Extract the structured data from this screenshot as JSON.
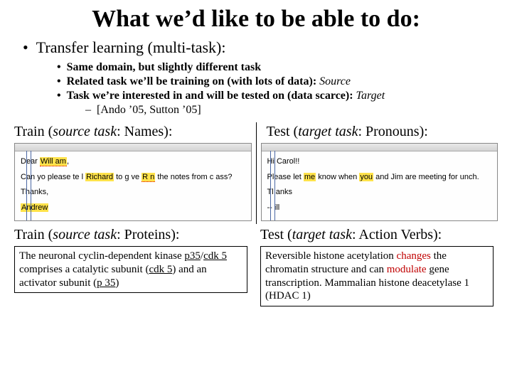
{
  "title": "What we’d like to be able to do:",
  "bullets": {
    "l1": "Transfer learning (multi-task):",
    "l2a": "Same domain, but slightly different task",
    "l2b_pre": "Related task we’ll be training on (with lots of data): ",
    "l2b_em": "Source",
    "l2c_pre": "Task we’re interested in and will be tested on (data scarce): ",
    "l2c_em": "Target",
    "l3": "[Ando ’05, Sutton ’05]"
  },
  "train_names": {
    "label_pre": "Train (",
    "label_em": "source task",
    "label_post": ": Names):",
    "greeting_pre": "Dear ",
    "greeting_hl": "Will am",
    "greeting_post": ",",
    "line_a": "Can yo  please te l ",
    "line_b": "Richard",
    "line_c": " to g ve ",
    "line_d": "R n",
    "line_e": " the notes from c ass?",
    "thanks": "Thanks,",
    "sig": "Andrew"
  },
  "test_pronouns": {
    "label_pre": "Test (",
    "label_em": "target task",
    "label_post": ": Pronouns):",
    "greeting": "Hi Carol!!",
    "line_a": "Please let ",
    "line_b": "me",
    "line_c": " know when ",
    "line_d": "you",
    "line_e": " and Jim are meeting for  unch.",
    "thanks": "Tl anks",
    "sig": "--  ill"
  },
  "train_proteins": {
    "label_pre": "Train (",
    "label_em": "source task",
    "label_post": ": Proteins):",
    "t1": "The neuronal cyclin-dependent kinase ",
    "u1": "p35",
    "slash": "/",
    "u2": "cdk 5",
    "t2": " comprises a catalytic subunit (",
    "u3": "cdk 5",
    "t3": ") and an activator subunit (",
    "u4": "p 35",
    "t4": ")"
  },
  "test_verbs": {
    "label_pre": "Test (",
    "label_em": "target task",
    "label_post": ": Action Verbs):",
    "t1": "Reversible histone acetylation ",
    "r1": "changes",
    "t2": " the chromatin structure and can ",
    "r2": "modulate",
    "t3": " gene transcription. Mammalian histone deacetylase 1 (HDAC 1)"
  }
}
